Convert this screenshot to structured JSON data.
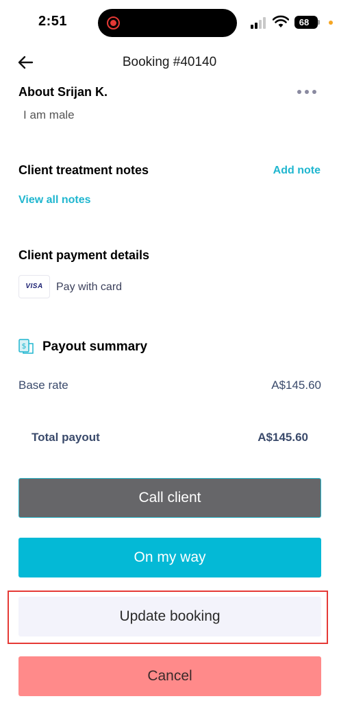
{
  "status_bar": {
    "time": "2:51",
    "battery": "68"
  },
  "header": {
    "title": "Booking #40140"
  },
  "about": {
    "title": "About Srijan K.",
    "text": "I am male"
  },
  "notes": {
    "title": "Client treatment notes",
    "add_label": "Add note",
    "view_all_label": "View all notes"
  },
  "payment": {
    "title": "Client payment details",
    "card_brand": "VISA",
    "method": "Pay with card"
  },
  "payout": {
    "title": "Payout summary",
    "base_label": "Base rate",
    "base_value": "A$145.60",
    "total_label": "Total payout",
    "total_value": "A$145.60"
  },
  "actions": {
    "call": "Call client",
    "on_my_way": "On my way",
    "update": "Update booking",
    "cancel": "Cancel"
  },
  "colors": {
    "accent": "#04b9d6",
    "link": "#1fb6cf",
    "call_bg": "#666669",
    "cancel_bg": "#ff8a8a",
    "highlight": "#e53935"
  },
  "icons": [
    "back-arrow-icon",
    "more-dots-icon",
    "visa-card-icon",
    "payout-icon",
    "record-icon",
    "signal-icon",
    "wifi-icon",
    "battery-icon"
  ]
}
